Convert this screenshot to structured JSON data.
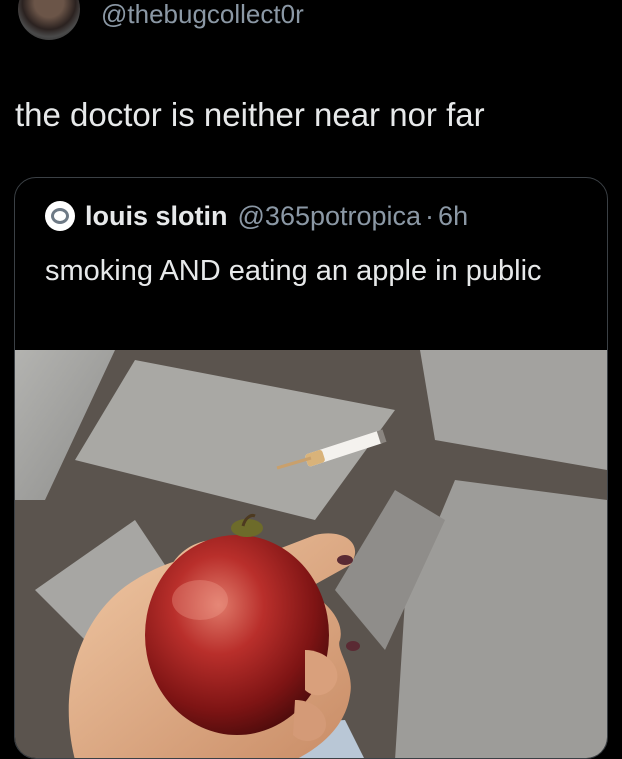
{
  "tweet": {
    "handle": "@thebugcollect0r",
    "text": "the doctor is neither near nor far"
  },
  "quote": {
    "name": "louis slotin",
    "handle": "@365potropica",
    "separator": "·",
    "time": "6h",
    "text": "smoking AND eating an apple in public"
  },
  "colors": {
    "background": "#000000",
    "primary_text": "#e7e9ea",
    "secondary_text": "#8b98a5",
    "card_border": "#3b4045"
  }
}
